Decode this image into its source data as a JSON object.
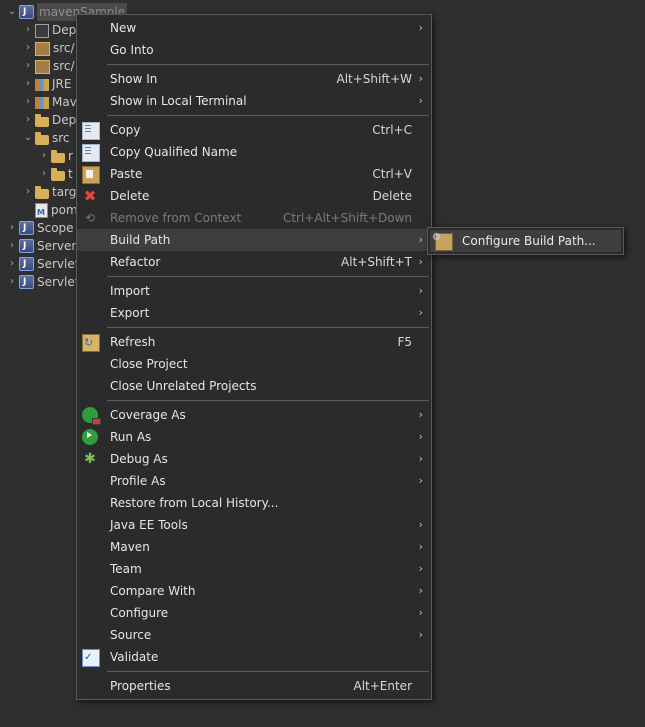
{
  "tree": {
    "items": [
      {
        "label": "mavenSample",
        "icon": "project-icon",
        "indent": 0,
        "expanded": true,
        "selected": true
      },
      {
        "label": "Dep",
        "icon": "deployment-descriptor-icon",
        "indent": 1
      },
      {
        "label": "src/",
        "icon": "source-folder-icon",
        "indent": 1
      },
      {
        "label": "src/",
        "icon": "source-folder-icon",
        "indent": 1
      },
      {
        "label": "JRE",
        "icon": "library-icon",
        "indent": 1
      },
      {
        "label": "Mav",
        "icon": "library-icon",
        "indent": 1
      },
      {
        "label": "Dep",
        "icon": "folder-icon",
        "indent": 1
      },
      {
        "label": "src",
        "icon": "folder-icon",
        "indent": 1,
        "expanded": true
      },
      {
        "label": "r",
        "icon": "folder-icon",
        "indent": 2
      },
      {
        "label": "t",
        "icon": "folder-icon",
        "indent": 2
      },
      {
        "label": "targ",
        "icon": "folder-icon",
        "indent": 1
      },
      {
        "label": "pom",
        "icon": "maven-pom-file-icon",
        "indent": 1,
        "noarrow": true
      },
      {
        "label": "Scope",
        "icon": "project-icon",
        "indent": 0
      },
      {
        "label": "Server",
        "icon": "project-icon",
        "indent": 0
      },
      {
        "label": "Servlet",
        "icon": "project-icon",
        "indent": 0
      },
      {
        "label": "Servlet",
        "icon": "project-icon",
        "indent": 0
      }
    ]
  },
  "menu": {
    "groups": [
      [
        {
          "label": "New",
          "submenu": true
        },
        {
          "label": "Go Into"
        }
      ],
      [
        {
          "label": "Show In",
          "accel": "Alt+Shift+W",
          "submenu": true
        },
        {
          "label": "Show in Local Terminal",
          "submenu": true
        }
      ],
      [
        {
          "label": "Copy",
          "accel": "Ctrl+C",
          "icon": "copy-icon"
        },
        {
          "label": "Copy Qualified Name",
          "icon": "copy-qualified-name-icon"
        },
        {
          "label": "Paste",
          "accel": "Ctrl+V",
          "icon": "paste-icon"
        },
        {
          "label": "Delete",
          "accel": "Delete",
          "icon": "delete-icon"
        },
        {
          "label": "Remove from Context",
          "accel": "Ctrl+Alt+Shift+Down",
          "icon": "remove-from-context-icon",
          "disabled": true
        },
        {
          "label": "Build Path",
          "submenu": true,
          "highlight": true
        },
        {
          "label": "Refactor",
          "accel": "Alt+Shift+T",
          "submenu": true
        }
      ],
      [
        {
          "label": "Import",
          "submenu": true
        },
        {
          "label": "Export",
          "submenu": true
        }
      ],
      [
        {
          "label": "Refresh",
          "accel": "F5",
          "icon": "refresh-icon"
        },
        {
          "label": "Close Project"
        },
        {
          "label": "Close Unrelated Projects"
        }
      ],
      [
        {
          "label": "Coverage As",
          "submenu": true,
          "icon": "coverage-icon"
        },
        {
          "label": "Run As",
          "submenu": true,
          "icon": "run-icon"
        },
        {
          "label": "Debug As",
          "submenu": true,
          "icon": "debug-icon"
        },
        {
          "label": "Profile As",
          "submenu": true
        },
        {
          "label": "Restore from Local History..."
        },
        {
          "label": "Java EE Tools",
          "submenu": true
        },
        {
          "label": "Maven",
          "submenu": true
        },
        {
          "label": "Team",
          "submenu": true
        },
        {
          "label": "Compare With",
          "submenu": true
        },
        {
          "label": "Configure",
          "submenu": true
        },
        {
          "label": "Source",
          "submenu": true
        },
        {
          "label": "Validate",
          "icon": "validate-icon"
        }
      ],
      [
        {
          "label": "Properties",
          "accel": "Alt+Enter"
        }
      ]
    ],
    "submenu_arrow": "›"
  },
  "submenu": {
    "items": [
      {
        "label": "Configure Build Path...",
        "icon": "configure-build-path-icon"
      }
    ]
  },
  "colors": {
    "background": "#2f2f2f",
    "menu_background": "#2b2b2b",
    "highlight": "#3e3e40",
    "text": "#e6e6e6",
    "disabled_text": "#7a7a7a",
    "delete_red": "#e0473f"
  }
}
